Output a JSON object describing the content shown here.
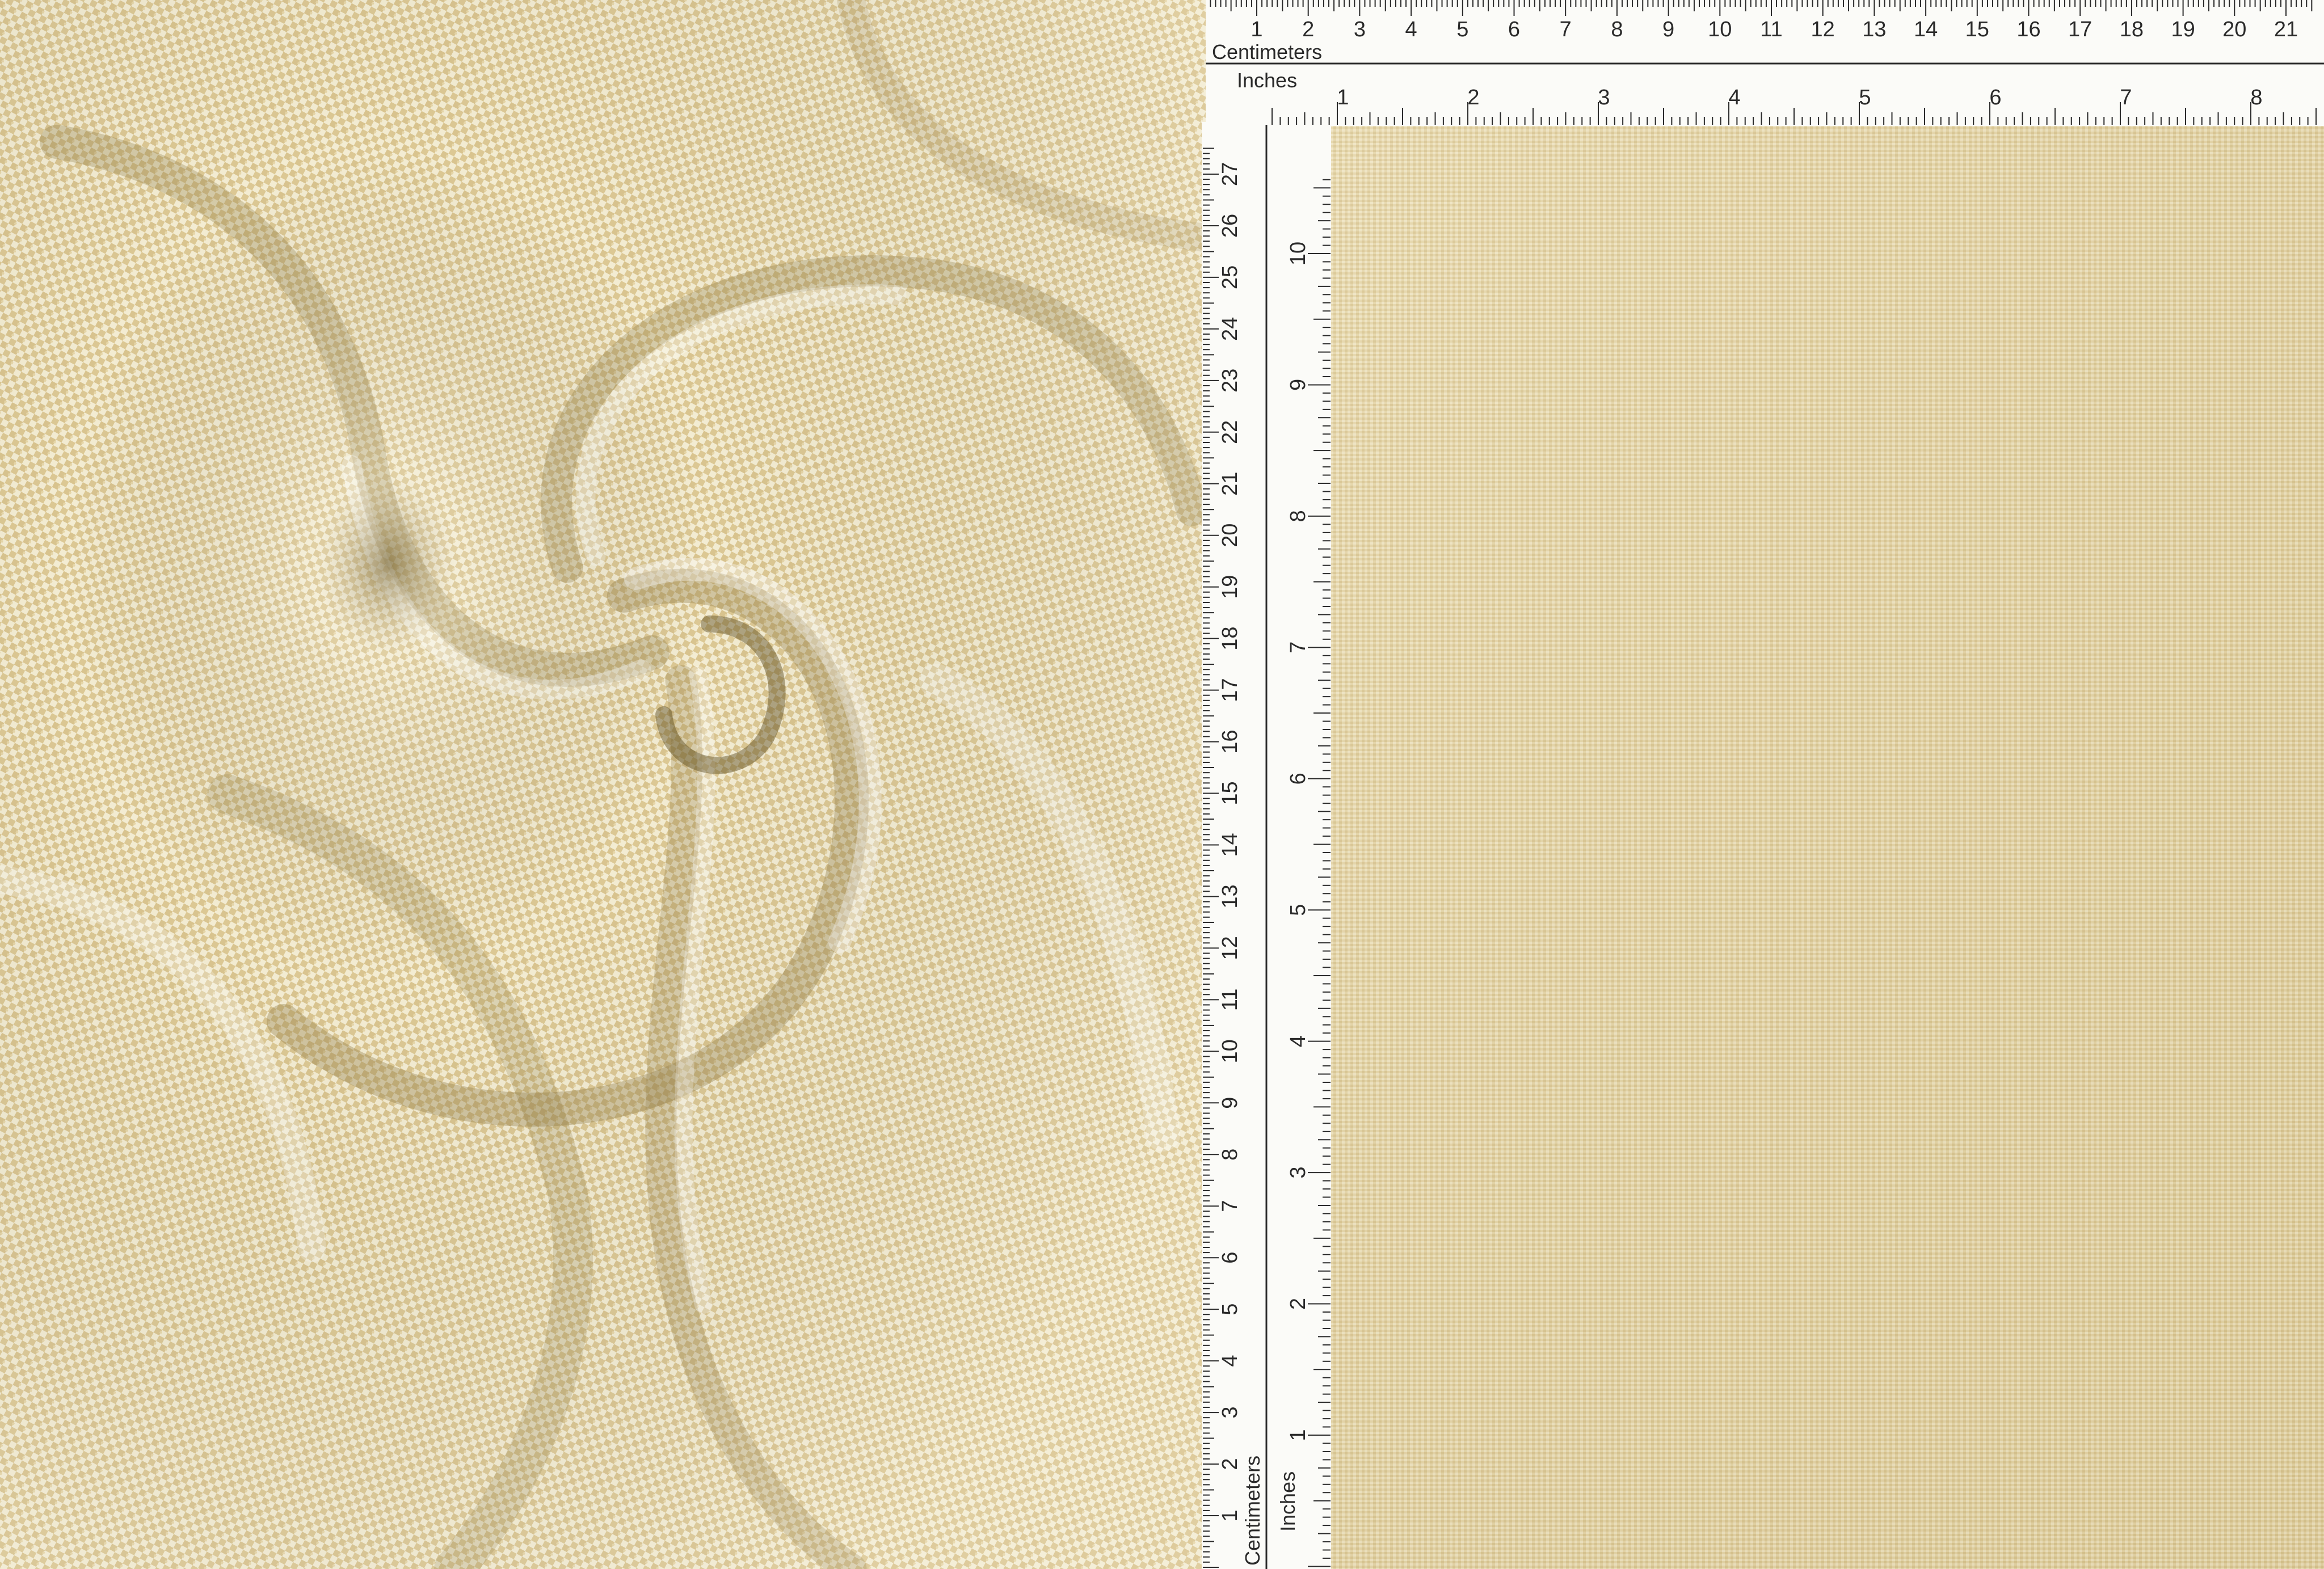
{
  "rulers": {
    "top_cm_numbers": [
      "1",
      "2",
      "3",
      "4",
      "5",
      "6",
      "7",
      "8",
      "9",
      "10",
      "11",
      "12",
      "13",
      "14",
      "15",
      "16",
      "17",
      "18",
      "19",
      "20",
      "21"
    ],
    "top_cm_label": "Centimeters",
    "top_in_label": "Inches",
    "top_in_numbers": [
      "1",
      "2",
      "3",
      "4",
      "5",
      "6",
      "7",
      "8"
    ],
    "left_cm_numbers": [
      "1",
      "2",
      "3",
      "4",
      "5",
      "6",
      "7",
      "8",
      "9",
      "10",
      "11",
      "12",
      "13",
      "14",
      "15",
      "16",
      "17",
      "18",
      "19",
      "20",
      "21",
      "22",
      "23",
      "24",
      "25",
      "26",
      "27"
    ],
    "left_in_numbers": [
      "1",
      "2",
      "3",
      "4",
      "5",
      "6",
      "7",
      "8",
      "9",
      "10"
    ],
    "left_cm_label": "Centimeters",
    "left_in_label": "Inches"
  },
  "colors": {
    "fabric_tan": "#d9c48f",
    "fabric_cream": "#f3ecd2",
    "swatch_base": "#e6d7ab",
    "ruler_white": "#fbfbf8",
    "ruler_ink": "#2a2a2a"
  }
}
